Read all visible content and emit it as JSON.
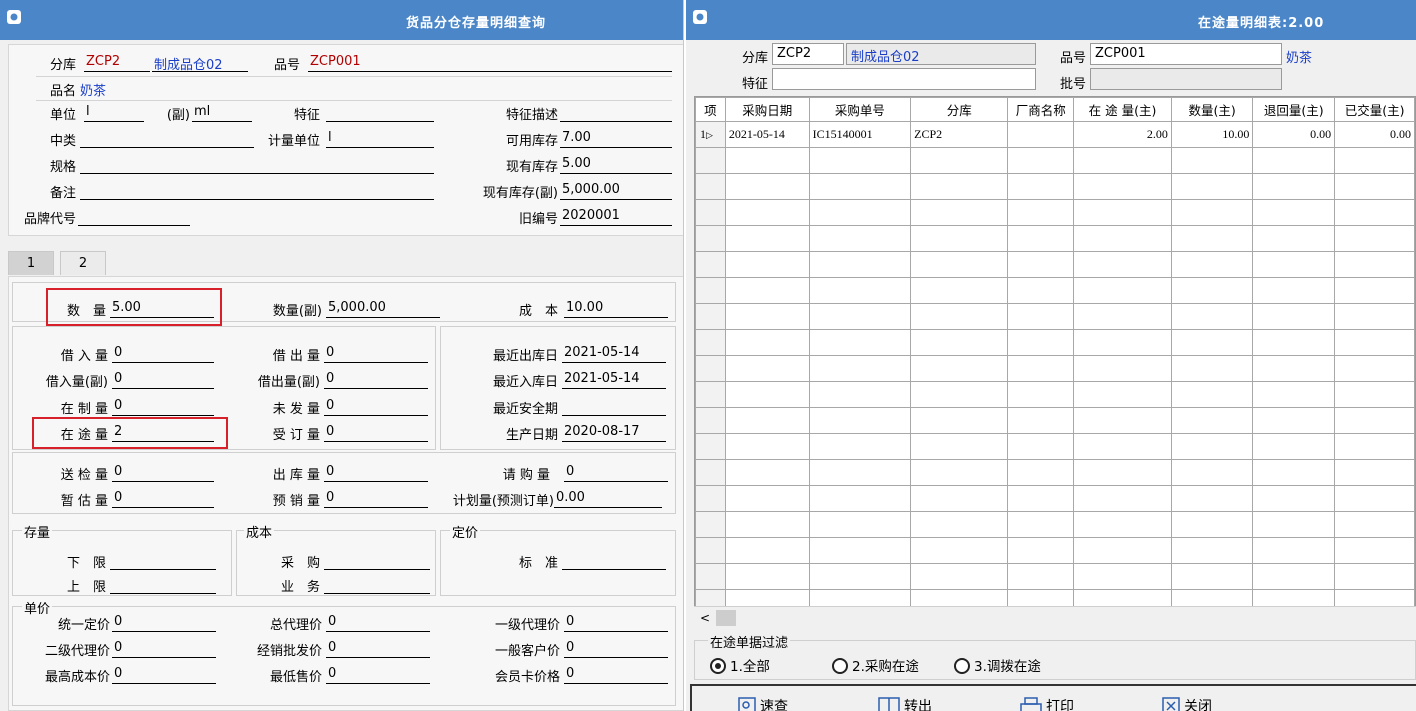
{
  "left": {
    "title": "货品分仓存量明细查询",
    "header": {
      "warehouse_label": "分库",
      "warehouse_code": "ZCP2",
      "warehouse_name": "制成品仓02",
      "item_label": "品号",
      "item_code": "ZCP001",
      "name_label": "品名",
      "name_value": "奶茶",
      "unit_label": "单位",
      "unit_value": "l",
      "sub_unit_label": "(副)",
      "sub_unit_value": "ml",
      "feature_label": "特征",
      "feature_value": "",
      "feature_desc_label": "特征描述",
      "feature_desc_value": "",
      "category_label": "中类",
      "category_value": "",
      "measure_unit_label": "计量单位",
      "measure_unit_value": "l",
      "available_label": "可用库存",
      "available_value": "7.00",
      "spec_label": "规格",
      "spec_value": "",
      "current_label": "现有库存",
      "current_value": "5.00",
      "note_label": "备注",
      "note_value": "",
      "current_sub_label": "现有库存(副)",
      "current_sub_value": "5,000.00",
      "brand_label": "品牌代号",
      "brand_value": "",
      "old_no_label": "旧编号",
      "old_no_value": "2020001"
    },
    "tabs": [
      "1",
      "2"
    ],
    "qty": {
      "qty_label": "数　量",
      "qty_value": "5.00",
      "qty_sub_label": "数量(副)",
      "qty_sub_value": "5,000.00",
      "cost_label": "成　本",
      "cost_value": "10.00",
      "borrow_in_label": "借 入 量",
      "borrow_in_value": "0",
      "borrow_out_label": "借 出 量",
      "borrow_out_value": "0",
      "last_out_label": "最近出库日",
      "last_out_value": "2021-05-14",
      "borrow_in_sub_label": "借入量(副)",
      "borrow_in_sub_value": "0",
      "borrow_out_sub_label": "借出量(副)",
      "borrow_out_sub_value": "0",
      "last_in_label": "最近入库日",
      "last_in_value": "2021-05-14",
      "wip_label": "在 制 量",
      "wip_value": "0",
      "unshipped_label": "未 发 量",
      "unshipped_value": "0",
      "safety_label": "最近安全期",
      "safety_value": "",
      "transit_label": "在 途 量",
      "transit_value": "2",
      "ordered_label": "受 订 量",
      "ordered_value": "0",
      "prod_date_label": "生产日期",
      "prod_date_value": "2020-08-17",
      "inspect_label": "送 检 量",
      "inspect_value": "0",
      "outbound_label": "出 库 量",
      "outbound_value": "0",
      "requisition_label": "请 购 量",
      "requisition_value": "0",
      "estimate_label": "暂 估 量",
      "estimate_value": "0",
      "presale_label": "预 销 量",
      "presale_value": "0",
      "plan_label": "计划量(预测订单)",
      "plan_value": "0.00"
    },
    "stock_group": {
      "title": "存量",
      "lower_label": "下　限",
      "lower_value": "",
      "upper_label": "上　限",
      "upper_value": ""
    },
    "cost_group": {
      "title": "成本",
      "purchase_label": "采　购",
      "purchase_value": "",
      "business_label": "业　务",
      "business_value": ""
    },
    "price_group": {
      "title": "定价",
      "standard_label": "标　准",
      "standard_value": ""
    },
    "unit_price": {
      "title": "单价",
      "unified_label": "统一定价",
      "unified_value": "0",
      "general_agent_label": "总代理价",
      "general_agent_value": "0",
      "first_agent_label": "一级代理价",
      "first_agent_value": "0",
      "second_agent_label": "二级代理价",
      "second_agent_value": "0",
      "wholesale_label": "经销批发价",
      "wholesale_value": "0",
      "customer_label": "一般客户价",
      "customer_value": "0",
      "max_cost_label": "最高成本价",
      "max_cost_value": "0",
      "min_sale_label": "最低售价",
      "min_sale_value": "0",
      "member_label": "会员卡价格",
      "member_value": "0"
    }
  },
  "right": {
    "title": "在途量明细表:2.00",
    "warehouse_label": "分库",
    "warehouse_code": "ZCP2",
    "warehouse_name": "制成品仓02",
    "item_label": "品号",
    "item_code": "ZCP001",
    "item_name": "奶茶",
    "feature_label": "特征",
    "feature_value": "",
    "batch_label": "批号",
    "batch_value": "",
    "columns": [
      "项",
      "采购日期",
      "采购单号",
      "分库",
      "厂商名称",
      "在 途 量(主)",
      "数量(主)",
      "退回量(主)",
      "已交量(主)"
    ],
    "rows": [
      [
        "1",
        "2021-05-14",
        "IC15140001",
        "ZCP2",
        "",
        "2.00",
        "10.00",
        "0.00",
        "0.00"
      ]
    ],
    "scroll_left": "<",
    "filter_title": "在途单据过滤",
    "filters": [
      "1.全部",
      "2.采购在途",
      "3.调拨在途"
    ],
    "buttons": [
      "速查",
      "转出",
      "打印",
      "关闭"
    ]
  }
}
